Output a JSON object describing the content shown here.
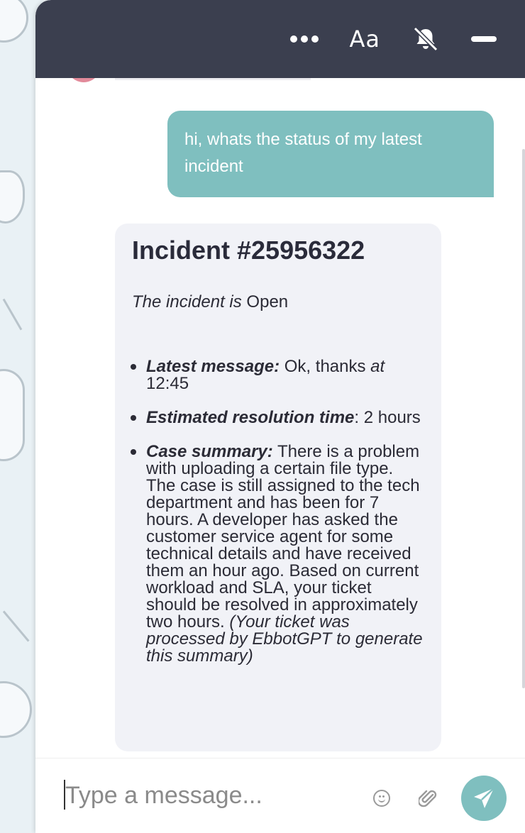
{
  "header": {
    "more_icon": "more-dots-icon",
    "font_size_label": "Aa",
    "mute_icon": "bell-muted-icon",
    "minimize_icon": "minus-icon"
  },
  "conversation": {
    "user_message": "hi, whats the status of my latest incident",
    "bot_card": {
      "title": "Incident #25956322",
      "status_prefix": "The incident is",
      "status_value": "Open",
      "items": [
        {
          "label": "Latest message:",
          "value": "Ok, thanks",
          "suffix_italic": "at",
          "time": "12:45"
        },
        {
          "label": "Estimated resolution time",
          "colon": ":",
          "value": "2 hours"
        },
        {
          "label": "Case summary:",
          "value": "There is a problem with uploading a certain file type. The case is still assigned to the tech department and has been for 7 hours. A developer has asked the customer service agent for some technical details and have received them an hour ago. Based on current workload and SLA, your ticket should be resolved in approximately two hours.",
          "note": "(Your ticket was processed by EbbotGPT to generate this summary)"
        }
      ]
    }
  },
  "composer": {
    "placeholder": "Type a message...",
    "emoji_icon": "emoji-icon",
    "attach_icon": "paperclip-icon",
    "send_icon": "send-plane-icon"
  },
  "colors": {
    "header_bg": "#3b3f4f",
    "accent": "#7fbfbf",
    "card_bg": "#f1f2f7"
  }
}
